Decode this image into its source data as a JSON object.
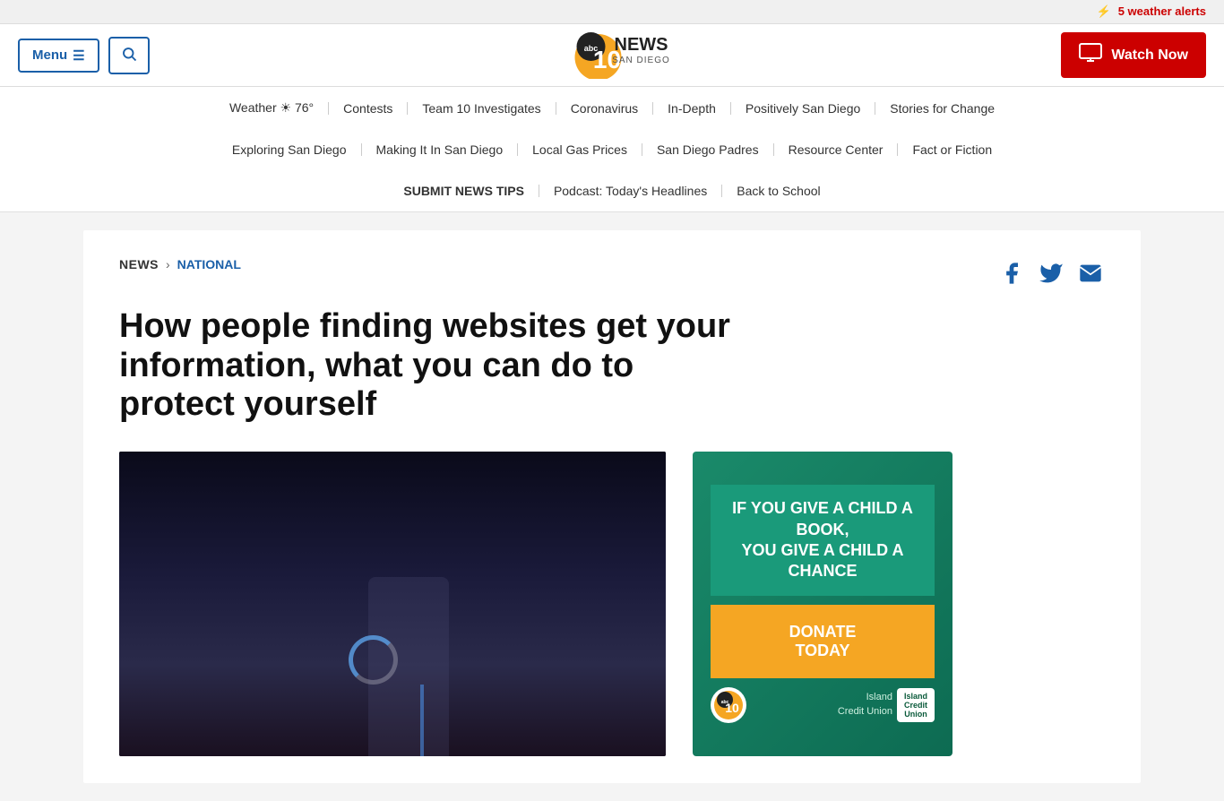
{
  "alert": {
    "text": "5 weather alerts",
    "icon": "⚡"
  },
  "header": {
    "menu_label": "Menu",
    "watch_now_label": "Watch Now",
    "logo_alt": "ABC 10 News San Diego"
  },
  "nav": {
    "row1": [
      {
        "label": "Weather ☀ 76°",
        "id": "weather"
      },
      {
        "label": "Contests",
        "id": "contests"
      },
      {
        "label": "Team 10 Investigates",
        "id": "team10"
      },
      {
        "label": "Coronavirus",
        "id": "coronavirus"
      },
      {
        "label": "In-Depth",
        "id": "indepth"
      },
      {
        "label": "Positively San Diego",
        "id": "positively"
      },
      {
        "label": "Stories for Change",
        "id": "stories"
      }
    ],
    "row2": [
      {
        "label": "Exploring San Diego",
        "id": "exploring"
      },
      {
        "label": "Making It In San Diego",
        "id": "making"
      },
      {
        "label": "Local Gas Prices",
        "id": "gas"
      },
      {
        "label": "San Diego Padres",
        "id": "padres"
      },
      {
        "label": "Resource Center",
        "id": "resource"
      },
      {
        "label": "Fact or Fiction",
        "id": "fact"
      }
    ],
    "row3": [
      {
        "label": "SUBMIT NEWS TIPS",
        "id": "submit"
      },
      {
        "label": "Podcast: Today's Headlines",
        "id": "podcast"
      },
      {
        "label": "Back to School",
        "id": "backtoschool"
      }
    ]
  },
  "breadcrumb": {
    "news_label": "NEWS",
    "separator": "›",
    "national_label": "NATIONAL"
  },
  "article": {
    "title": "How people finding websites get your information, what you can do to protect yourself"
  },
  "social": {
    "facebook_label": "Share on Facebook",
    "twitter_label": "Share on Twitter",
    "email_label": "Share via Email"
  },
  "ad": {
    "line1": "IF YOU GIVE A CHILD A BOOK,",
    "line2": "YOU GIVE A CHILD A CHANCE",
    "donate_label": "DONATE",
    "donate_sub": "TODAY",
    "sponsor": "Island\nCredit Union"
  }
}
